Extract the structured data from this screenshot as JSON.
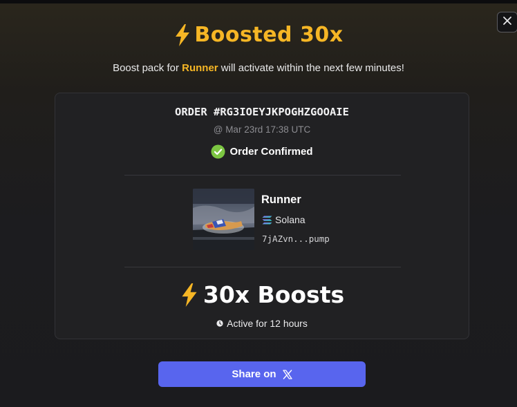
{
  "modal": {
    "title": "Boosted 30x",
    "subtitle_prefix": "Boost pack for ",
    "subtitle_token": "Runner",
    "subtitle_suffix": " will activate within the next few minutes!",
    "close_icon": "close-icon"
  },
  "order": {
    "id_text": "ORDER #RG3IOEYJKPOGHZGOOAIE",
    "date_text": "@ Mar 23rd 17:38 UTC",
    "status_text": "Order Confirmed",
    "status_icon": "check-circle-icon",
    "status_color": "#7cc642"
  },
  "token": {
    "name": "Runner",
    "chain": "Solana",
    "chain_icon": "solana-icon",
    "address": "7jAZvn...pump"
  },
  "boost": {
    "amount_text": "30x Boosts",
    "duration_text": "Active for 12 hours",
    "icon": "lightning-icon",
    "accent_color": "#f6b625"
  },
  "share": {
    "label": "Share on",
    "icon": "x-logo-icon",
    "color": "#5865ee"
  }
}
